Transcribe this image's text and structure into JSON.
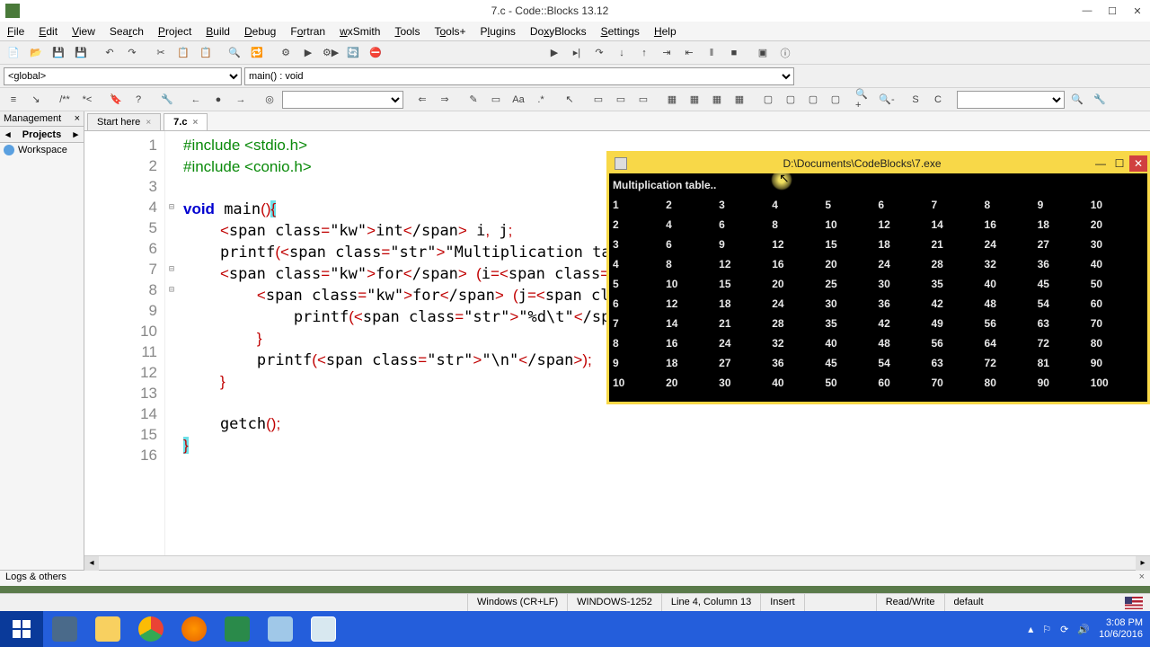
{
  "window": {
    "title": "7.c - Code::Blocks 13.12"
  },
  "menu": [
    "File",
    "Edit",
    "View",
    "Search",
    "Project",
    "Build",
    "Debug",
    "Fortran",
    "wxSmith",
    "Tools",
    "Tools+",
    "Plugins",
    "DoxyBlocks",
    "Settings",
    "Help"
  ],
  "scope_selectors": {
    "global": "<global>",
    "func": "main() : void"
  },
  "management": {
    "title": "Management",
    "tab": "Projects",
    "workspace": "Workspace"
  },
  "tabs": [
    {
      "label": "Start here",
      "active": false
    },
    {
      "label": "7.c",
      "active": true
    }
  ],
  "code": {
    "lines": [
      "#include <stdio.h>",
      "#include <conio.h>",
      "",
      "void main(){",
      "    int i, j;",
      "    printf(\"Multiplication table..\\n\");",
      "    for (i=1; i<=10; i++) {",
      "        for (j=1; j<=10; j++) {",
      "            printf(\"%d\\t\", i*j);",
      "        }",
      "        printf(\"\\n\");",
      "    }",
      "",
      "    getch();",
      "}",
      ""
    ]
  },
  "logs": {
    "label": "Logs & others"
  },
  "status": {
    "eol": "Windows (CR+LF)",
    "encoding": "WINDOWS-1252",
    "pos": "Line 4, Column 13",
    "ins": "Insert",
    "rw": "Read/Write",
    "profile": "default"
  },
  "console": {
    "title": "D:\\Documents\\CodeBlocks\\7.exe",
    "header": "Multiplication table..",
    "rows": [
      [
        1,
        2,
        3,
        4,
        5,
        6,
        7,
        8,
        9,
        10
      ],
      [
        2,
        4,
        6,
        8,
        10,
        12,
        14,
        16,
        18,
        20
      ],
      [
        3,
        6,
        9,
        12,
        15,
        18,
        21,
        24,
        27,
        30
      ],
      [
        4,
        8,
        12,
        16,
        20,
        24,
        28,
        32,
        36,
        40
      ],
      [
        5,
        10,
        15,
        20,
        25,
        30,
        35,
        40,
        45,
        50
      ],
      [
        6,
        12,
        18,
        24,
        30,
        36,
        42,
        48,
        54,
        60
      ],
      [
        7,
        14,
        21,
        28,
        35,
        42,
        49,
        56,
        63,
        70
      ],
      [
        8,
        16,
        24,
        32,
        40,
        48,
        56,
        64,
        72,
        80
      ],
      [
        9,
        18,
        27,
        36,
        45,
        54,
        63,
        72,
        81,
        90
      ],
      [
        10,
        20,
        30,
        40,
        50,
        60,
        70,
        80,
        90,
        100
      ]
    ]
  },
  "tray": {
    "time": "3:08 PM",
    "date": "10/6/2016"
  }
}
